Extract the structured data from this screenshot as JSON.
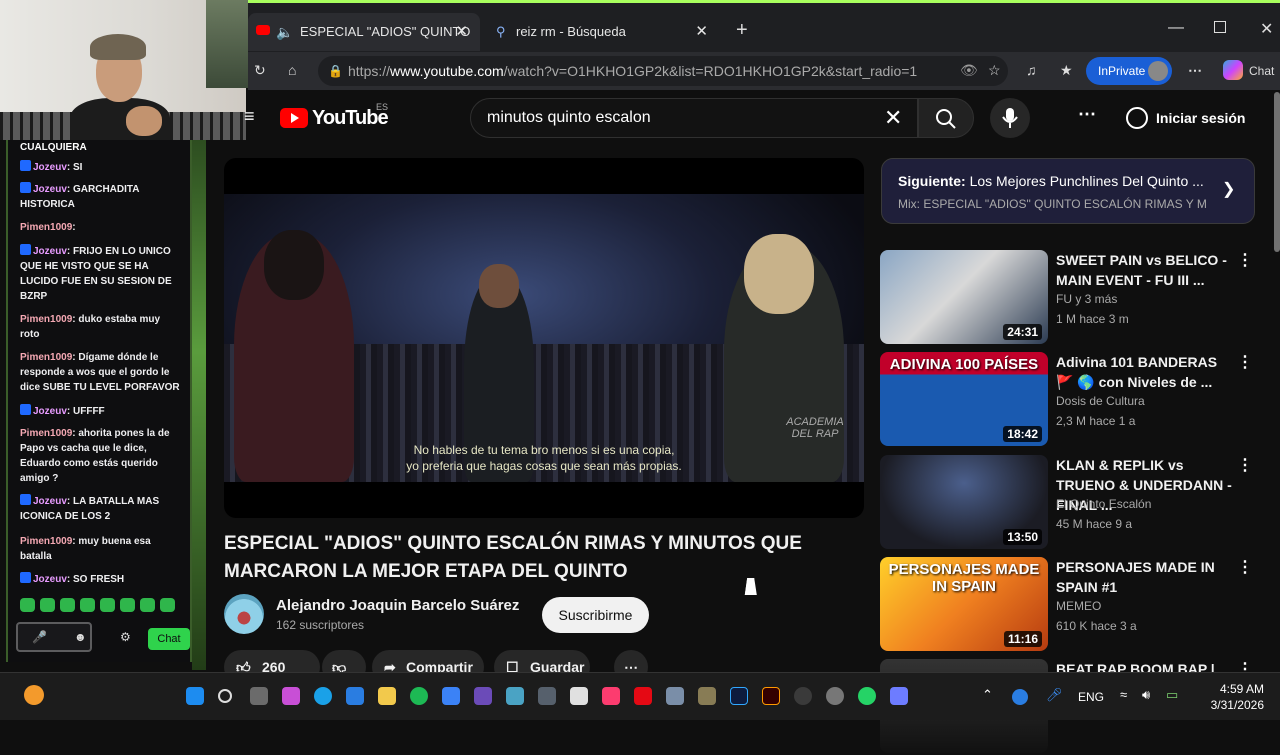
{
  "overlay": {
    "chat_top_text": "CUALQUIERA",
    "messages": [
      {
        "user": "Jozeuv",
        "text": ": SI",
        "kind": "joz"
      },
      {
        "user": "Jozeuv",
        "text": ": GARCHADITA HISTORICA",
        "kind": "joz"
      },
      {
        "user": "Pimen1009",
        "text": ":",
        "kind": "pimen"
      },
      {
        "user": "Jozeuv",
        "text": ": FRIJO EN LO UNICO QUE HE VISTO QUE SE HA LUCIDO FUE EN SU SESION DE BZRP",
        "kind": "joz"
      },
      {
        "user": "Pimen1009",
        "text": ": duko estaba muy roto",
        "kind": "pimen"
      },
      {
        "user": "Pimen1009",
        "text": ": Dígame dónde le responde a wos que el gordo le dice SUBE TU LEVEL PORFAVOR",
        "kind": "pimen"
      },
      {
        "user": "Jozeuv",
        "text": ": UFFFF",
        "kind": "joz"
      },
      {
        "user": "Pimen1009",
        "text": ": ahorita pones la de Papo vs cacha que le dice, Eduardo como estás querido amigo ?",
        "kind": "pimen"
      },
      {
        "user": "Jozeuv",
        "text": ": LA BATALLA MAS ICONICA DE LOS 2",
        "kind": "joz"
      },
      {
        "user": "Pimen1009",
        "text": ": muy buena esa batalla",
        "kind": "pimen"
      },
      {
        "user": "Jozeuv",
        "text": ": SO FRESH",
        "kind": "joz"
      }
    ],
    "chat_button": "Chat"
  },
  "browser": {
    "tabs": [
      {
        "label": "ESPECIAL \"ADIOS\" QUINTO ES",
        "active": true
      },
      {
        "label": "reiz rm - Búsqueda",
        "active": false
      }
    ],
    "url_prefix": "https://",
    "url_host": "www.youtube.com",
    "url_path": "/watch?v=O1HKHO1GP2k&list=RDO1HKHO1GP2k&start_radio=1",
    "inprivate_label": "InPrivate",
    "copilot_label": "Chat"
  },
  "youtube": {
    "logo_text": "YouTube",
    "region": "ES",
    "search_value": "minutos quinto escalon",
    "signin_label": "Iniciar sesión",
    "video": {
      "subtitle_line1": "No hables de tu tema bro menos si es una copia,",
      "subtitle_line2": "yo preferia que hagas cosas que sean más propias.",
      "watermark": "ACADEMIA DEL RAP",
      "title": "ESPECIAL \"ADIOS\" QUINTO ESCALÓN RIMAS Y MINUTOS QUE MARCARON LA MEJOR ETAPA DEL QUINTO",
      "channel": "Alejandro Joaquin Barcelo Suárez",
      "subscribers": "162 suscriptores",
      "subscribe_label": "Suscribirme",
      "likes": "260",
      "share_label": "Compartir",
      "save_label": "Guardar"
    },
    "up_next": {
      "prefix": "Siguiente:",
      "title": "Los Mejores Punchlines Del Quinto ...",
      "mix": "Mix: ESPECIAL \"ADIOS\" QUINTO ESCALÓN RIMAS Y MINU"
    },
    "recommendations": [
      {
        "title": "SWEET PAIN vs BELICO - MAIN EVENT - FU III ...",
        "channel": "FU y 3 más",
        "meta": "1 M  hace 3 m",
        "duration": "24:31"
      },
      {
        "title": "Adivina 101 BANDERAS 🚩 🌎 con Niveles de ...",
        "channel": "Dosis de Cultura",
        "meta": "2,3 M  hace 1 a",
        "duration": "18:42",
        "thumb_text": "ADIVINA 100 PAÍSES"
      },
      {
        "title": "KLAN & REPLIK vs TRUENO & UNDERDANN - FINAL ...",
        "channel": "El Quinto Escalón",
        "meta": "45 M  hace 9 a",
        "duration": "13:50"
      },
      {
        "title": "PERSONAJES MADE IN SPAIN #1",
        "channel": "MEMEO",
        "meta": "610 K  hace 3 a",
        "duration": "11:16",
        "thumb_text": "PERSONAJES MADE IN SPAIN"
      },
      {
        "title": "BEAT RAP BOOM BAP |",
        "channel": "",
        "meta": "",
        "duration": ""
      }
    ]
  },
  "taskbar": {
    "lang": "ENG",
    "time": "4:59 AM",
    "date": "3/31/2026"
  }
}
